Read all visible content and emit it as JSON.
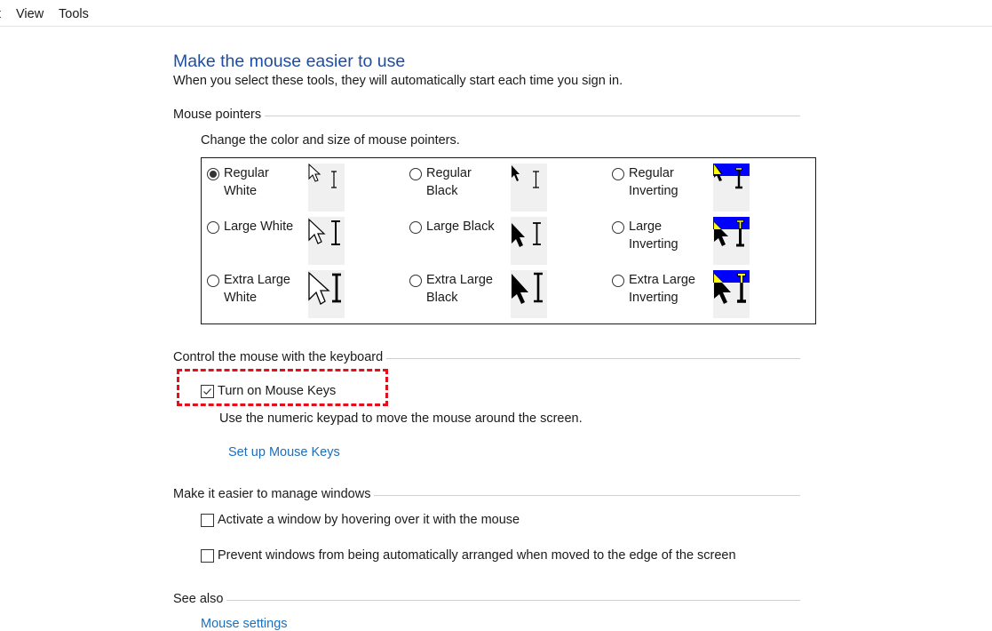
{
  "menubar": {
    "items": [
      {
        "label": "t"
      },
      {
        "label": "View"
      },
      {
        "label": "Tools"
      }
    ]
  },
  "header": {
    "title": "Make the mouse easier to use",
    "subtitle": "When you select these tools, they will automatically start each time you sign in."
  },
  "mouse_pointers": {
    "group_label": "Mouse pointers",
    "description": "Change the color and size of mouse pointers.",
    "selected": "Regular White",
    "options": [
      {
        "label": "Regular White",
        "scheme": "white",
        "size": "regular",
        "selected": true
      },
      {
        "label": "Regular Black",
        "scheme": "black",
        "size": "regular",
        "selected": false
      },
      {
        "label": "Regular Inverting",
        "scheme": "inverting",
        "size": "regular",
        "selected": false
      },
      {
        "label": "Large White",
        "scheme": "white",
        "size": "large",
        "selected": false
      },
      {
        "label": "Large Black",
        "scheme": "black",
        "size": "large",
        "selected": false
      },
      {
        "label": "Large Inverting",
        "scheme": "inverting",
        "size": "large",
        "selected": false
      },
      {
        "label": "Extra Large White",
        "scheme": "white",
        "size": "xlarge",
        "selected": false
      },
      {
        "label": "Extra Large Black",
        "scheme": "black",
        "size": "xlarge",
        "selected": false
      },
      {
        "label": "Extra Large Inverting",
        "scheme": "inverting",
        "size": "xlarge",
        "selected": false
      }
    ],
    "colors": {
      "invert_blue": "#0000ff",
      "invert_yellow": "#ffff00"
    }
  },
  "keyboard_control": {
    "group_label": "Control the mouse with the keyboard",
    "mouse_keys": {
      "label": "Turn on Mouse Keys",
      "checked": true
    },
    "mouse_keys_description": "Use the numeric keypad to move the mouse around the screen.",
    "setup_link": "Set up Mouse Keys",
    "highlight_color": "#e3101b"
  },
  "manage_windows": {
    "group_label": "Make it easier to manage windows",
    "options": [
      {
        "label": "Activate a window by hovering over it with the mouse",
        "checked": false
      },
      {
        "label": "Prevent windows from being automatically arranged when moved to the edge of the screen",
        "checked": false
      }
    ]
  },
  "see_also": {
    "group_label": "See also",
    "links": [
      "Mouse settings"
    ]
  }
}
